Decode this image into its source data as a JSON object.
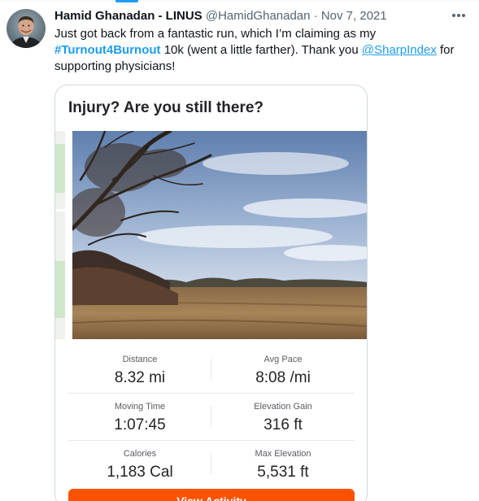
{
  "tweet": {
    "author_name": "Hamid Ghanadan - LINUS",
    "handle": "@HamidGhanadan",
    "separator": "·",
    "date": "Nov 7, 2021",
    "text_part1": "Just got back from a fantastic run, which I’m claiming as my ",
    "hashtag": "#Turnout4Burnout",
    "text_part2": " 10k (went a little farther). Thank you ",
    "mention": "@SharpIndex",
    "text_part3": " for supporting physicians!"
  },
  "card": {
    "title": "Injury? Are you still there?",
    "cta_label": "View Activity",
    "stats": [
      {
        "label": "Distance",
        "value": "8.32 mi"
      },
      {
        "label": "Avg Pace",
        "value": "8:08 /mi"
      },
      {
        "label": "Moving Time",
        "value": "1:07:45"
      },
      {
        "label": "Elevation Gain",
        "value": "316 ft"
      },
      {
        "label": "Calories",
        "value": "1,183 Cal"
      },
      {
        "label": "Max Elevation",
        "value": "5,531 ft"
      }
    ]
  },
  "icons": {
    "more": "more-horizontal-icon"
  },
  "colors": {
    "accent": "#1d9bf0",
    "strava_orange": "#fc5200",
    "text_primary": "#0f1419",
    "text_secondary": "#536471"
  }
}
